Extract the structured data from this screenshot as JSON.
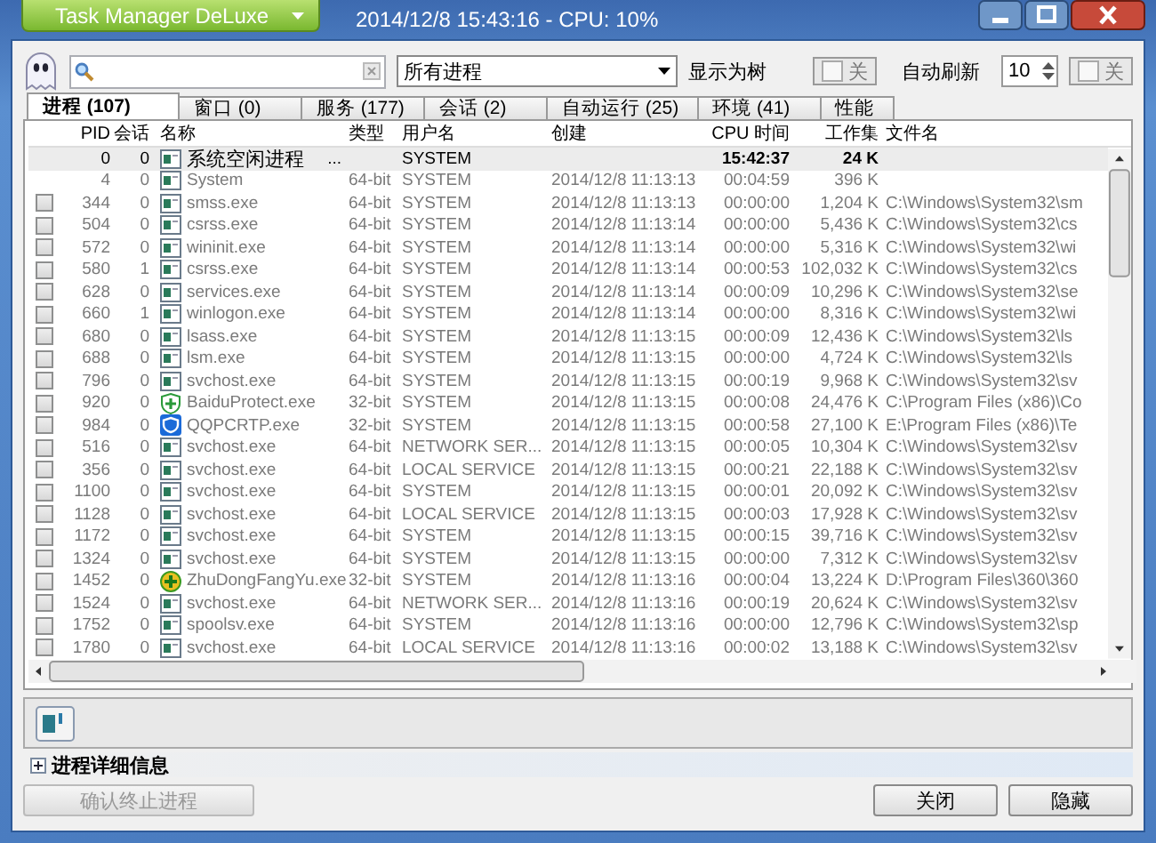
{
  "window": {
    "title": "Task Manager DeLuxe",
    "status": "2014/12/8 15:43:16 - CPU: 10%"
  },
  "toolbar": {
    "filter": "所有进程",
    "tree_label": "显示为树",
    "tree_toggle": {
      "label": "关",
      "on": false
    },
    "refresh_label": "自动刷新",
    "refresh_interval": "10",
    "refresh_toggle": {
      "label": "关",
      "on": false
    }
  },
  "tabs": [
    {
      "label": "进程 (107)",
      "selected": true
    },
    {
      "label": "窗口 (0)",
      "selected": false
    },
    {
      "label": "服务 (177)",
      "selected": false
    },
    {
      "label": "会话 (2)",
      "selected": false
    },
    {
      "label": "自动运行 (25)",
      "selected": false
    },
    {
      "label": "环境 (41)",
      "selected": false
    },
    {
      "label": "性能",
      "selected": false
    }
  ],
  "table": {
    "columns": [
      "PID",
      "会话",
      "名称",
      "类型",
      "用户名",
      "创建",
      "CPU 时间",
      "工作集",
      "文件名"
    ],
    "rows": [
      {
        "pid": "0",
        "session": "0",
        "name": "系统空闲进程",
        "suffix": "...",
        "kind": "window",
        "type": "",
        "user": "SYSTEM",
        "created": "",
        "cpu": "15:42:37",
        "memory": "24 K",
        "path": "",
        "selected": true
      },
      {
        "pid": "4",
        "session": "0",
        "name": "System",
        "kind": "window",
        "type": "64-bit",
        "user": "SYSTEM",
        "created": "2014/12/8 11:13:13",
        "cpu": "00:04:59",
        "memory": "396 K",
        "path": "",
        "selected": false
      },
      {
        "pid": "344",
        "session": "0",
        "name": "smss.exe",
        "kind": "window",
        "type": "64-bit",
        "user": "SYSTEM",
        "created": "2014/12/8 11:13:13",
        "cpu": "00:00:00",
        "memory": "1,204 K",
        "path": "C:\\Windows\\System32\\sm",
        "checked": false,
        "selected": false
      },
      {
        "pid": "504",
        "session": "0",
        "name": "csrss.exe",
        "kind": "window",
        "type": "64-bit",
        "user": "SYSTEM",
        "created": "2014/12/8 11:13:14",
        "cpu": "00:00:00",
        "memory": "5,436 K",
        "path": "C:\\Windows\\System32\\cs",
        "checked": false,
        "selected": false
      },
      {
        "pid": "572",
        "session": "0",
        "name": "wininit.exe",
        "kind": "window",
        "type": "64-bit",
        "user": "SYSTEM",
        "created": "2014/12/8 11:13:14",
        "cpu": "00:00:00",
        "memory": "5,316 K",
        "path": "C:\\Windows\\System32\\wi",
        "checked": false,
        "selected": false
      },
      {
        "pid": "580",
        "session": "1",
        "name": "csrss.exe",
        "kind": "window",
        "type": "64-bit",
        "user": "SYSTEM",
        "created": "2014/12/8 11:13:14",
        "cpu": "00:00:53",
        "memory": "102,032 K",
        "path": "C:\\Windows\\System32\\cs",
        "checked": false,
        "selected": false
      },
      {
        "pid": "628",
        "session": "0",
        "name": "services.exe",
        "kind": "window",
        "type": "64-bit",
        "user": "SYSTEM",
        "created": "2014/12/8 11:13:14",
        "cpu": "00:00:09",
        "memory": "10,296 K",
        "path": "C:\\Windows\\System32\\se",
        "checked": false,
        "selected": false
      },
      {
        "pid": "660",
        "session": "1",
        "name": "winlogon.exe",
        "kind": "window",
        "type": "64-bit",
        "user": "SYSTEM",
        "created": "2014/12/8 11:13:14",
        "cpu": "00:00:00",
        "memory": "8,316 K",
        "path": "C:\\Windows\\System32\\wi",
        "checked": false,
        "selected": false
      },
      {
        "pid": "680",
        "session": "0",
        "name": "lsass.exe",
        "kind": "window",
        "type": "64-bit",
        "user": "SYSTEM",
        "created": "2014/12/8 11:13:15",
        "cpu": "00:00:09",
        "memory": "12,436 K",
        "path": "C:\\Windows\\System32\\ls",
        "checked": false,
        "selected": false
      },
      {
        "pid": "688",
        "session": "0",
        "name": "lsm.exe",
        "kind": "window",
        "type": "64-bit",
        "user": "SYSTEM",
        "created": "2014/12/8 11:13:15",
        "cpu": "00:00:00",
        "memory": "4,724 K",
        "path": "C:\\Windows\\System32\\ls",
        "checked": false,
        "selected": false
      },
      {
        "pid": "796",
        "session": "0",
        "name": "svchost.exe",
        "kind": "window",
        "type": "64-bit",
        "user": "SYSTEM",
        "created": "2014/12/8 11:13:15",
        "cpu": "00:00:19",
        "memory": "9,968 K",
        "path": "C:\\Windows\\System32\\sv",
        "checked": false,
        "selected": false
      },
      {
        "pid": "920",
        "session": "0",
        "name": "BaiduProtect.exe",
        "kind": "shield-plus",
        "type": "32-bit",
        "user": "SYSTEM",
        "created": "2014/12/8 11:13:15",
        "cpu": "00:00:08",
        "memory": "24,476 K",
        "path": "C:\\Program Files (x86)\\Co",
        "checked": false,
        "selected": false
      },
      {
        "pid": "984",
        "session": "0",
        "name": "QQPCRTP.exe",
        "kind": "shield",
        "type": "32-bit",
        "user": "SYSTEM",
        "created": "2014/12/8 11:13:15",
        "cpu": "00:00:58",
        "memory": "27,100 K",
        "path": "E:\\Program Files (x86)\\Te",
        "checked": false,
        "selected": false
      },
      {
        "pid": "516",
        "session": "0",
        "name": "svchost.exe",
        "kind": "window",
        "type": "64-bit",
        "user": "NETWORK SER...",
        "created": "2014/12/8 11:13:15",
        "cpu": "00:00:05",
        "memory": "10,304 K",
        "path": "C:\\Windows\\System32\\sv",
        "checked": false,
        "selected": false
      },
      {
        "pid": "356",
        "session": "0",
        "name": "svchost.exe",
        "kind": "window",
        "type": "64-bit",
        "user": "LOCAL SERVICE",
        "created": "2014/12/8 11:13:15",
        "cpu": "00:00:21",
        "memory": "22,188 K",
        "path": "C:\\Windows\\System32\\sv",
        "checked": false,
        "selected": false
      },
      {
        "pid": "1100",
        "session": "0",
        "name": "svchost.exe",
        "kind": "window",
        "type": "64-bit",
        "user": "SYSTEM",
        "created": "2014/12/8 11:13:15",
        "cpu": "00:00:01",
        "memory": "20,092 K",
        "path": "C:\\Windows\\System32\\sv",
        "checked": false,
        "selected": false
      },
      {
        "pid": "1128",
        "session": "0",
        "name": "svchost.exe",
        "kind": "window",
        "type": "64-bit",
        "user": "LOCAL SERVICE",
        "created": "2014/12/8 11:13:15",
        "cpu": "00:00:03",
        "memory": "17,928 K",
        "path": "C:\\Windows\\System32\\sv",
        "checked": false,
        "selected": false
      },
      {
        "pid": "1172",
        "session": "0",
        "name": "svchost.exe",
        "kind": "window",
        "type": "64-bit",
        "user": "SYSTEM",
        "created": "2014/12/8 11:13:15",
        "cpu": "00:00:15",
        "memory": "39,716 K",
        "path": "C:\\Windows\\System32\\sv",
        "checked": false,
        "selected": false
      },
      {
        "pid": "1324",
        "session": "0",
        "name": "svchost.exe",
        "kind": "window",
        "type": "64-bit",
        "user": "SYSTEM",
        "created": "2014/12/8 11:13:15",
        "cpu": "00:00:00",
        "memory": "7,312 K",
        "path": "C:\\Windows\\System32\\sv",
        "checked": false,
        "selected": false
      },
      {
        "pid": "1452",
        "session": "0",
        "name": "ZhuDongFangYu.exe",
        "kind": "circle-plus",
        "type": "32-bit",
        "user": "SYSTEM",
        "created": "2014/12/8 11:13:16",
        "cpu": "00:00:04",
        "memory": "13,224 K",
        "path": "D:\\Program Files\\360\\360",
        "checked": false,
        "selected": false
      },
      {
        "pid": "1524",
        "session": "0",
        "name": "svchost.exe",
        "kind": "window",
        "type": "64-bit",
        "user": "NETWORK SER...",
        "created": "2014/12/8 11:13:16",
        "cpu": "00:00:19",
        "memory": "20,624 K",
        "path": "C:\\Windows\\System32\\sv",
        "checked": false,
        "selected": false
      },
      {
        "pid": "1752",
        "session": "0",
        "name": "spoolsv.exe",
        "kind": "window",
        "type": "64-bit",
        "user": "SYSTEM",
        "created": "2014/12/8 11:13:16",
        "cpu": "00:00:00",
        "memory": "12,796 K",
        "path": "C:\\Windows\\System32\\sp",
        "checked": false,
        "selected": false
      },
      {
        "pid": "1780",
        "session": "0",
        "name": "svchost.exe",
        "kind": "window",
        "type": "64-bit",
        "user": "LOCAL SERVICE",
        "created": "2014/12/8 11:13:16",
        "cpu": "00:00:02",
        "memory": "13,188 K",
        "path": "C:\\Windows\\System32\\sv",
        "checked": false,
        "selected": false
      }
    ]
  },
  "details": {
    "label": "进程详细信息",
    "expanded": false
  },
  "buttons": [
    {
      "label": "确认终止进程",
      "disabled": true
    },
    {
      "label": "关闭",
      "disabled": false
    },
    {
      "label": "隐藏",
      "disabled": false
    }
  ]
}
